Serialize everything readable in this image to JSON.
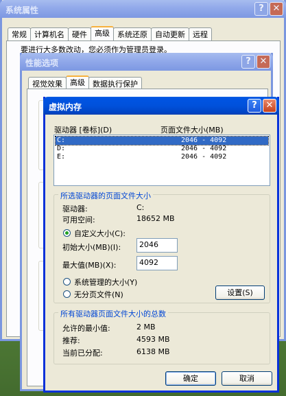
{
  "system_properties": {
    "title": "系统属性",
    "tabs": [
      "常规",
      "计算机名",
      "硬件",
      "高级",
      "系统还原",
      "自动更新",
      "远程"
    ],
    "notice": "要进行大多数改动，您必须作为管理员登录。"
  },
  "performance_options": {
    "title": "性能选项",
    "tabs": [
      "视觉效果",
      "高级",
      "数据执行保护"
    ]
  },
  "virtual_memory": {
    "title": "虚拟内存",
    "list_header_drive": "驱动器 [卷标](D)",
    "list_header_size": "页面文件大小(MB)",
    "drives": [
      {
        "drive": "C:",
        "size": "2046 - 4092"
      },
      {
        "drive": "D:",
        "size": "2046 - 4092"
      },
      {
        "drive": "E:",
        "size": "2046 - 4092"
      }
    ],
    "selected_group_title": "所选驱动器的页面文件大小",
    "drive_label": "驱动器:",
    "drive_value": "C:",
    "free_space_label": "可用空间:",
    "free_space_value": "18652 MB",
    "custom_size_label": "自定义大小(C):",
    "initial_size_label": "初始大小(MB)(I):",
    "initial_size_value": "2046",
    "max_size_label": "最大值(MB)(X):",
    "max_size_value": "4092",
    "system_managed_label": "系统管理的大小(Y)",
    "no_paging_label": "无分页文件(N)",
    "set_button": "设置(S)",
    "total_group_title": "所有驱动器页面文件大小的总数",
    "min_allowed_label": "允许的最小值:",
    "min_allowed_value": "2 MB",
    "recommended_label": "推荐:",
    "recommended_value": "4593 MB",
    "allocated_label": "当前已分配:",
    "allocated_value": "6138 MB",
    "ok_button": "确定",
    "cancel_button": "取消"
  },
  "icons": {
    "help": "?",
    "close": "✕"
  }
}
